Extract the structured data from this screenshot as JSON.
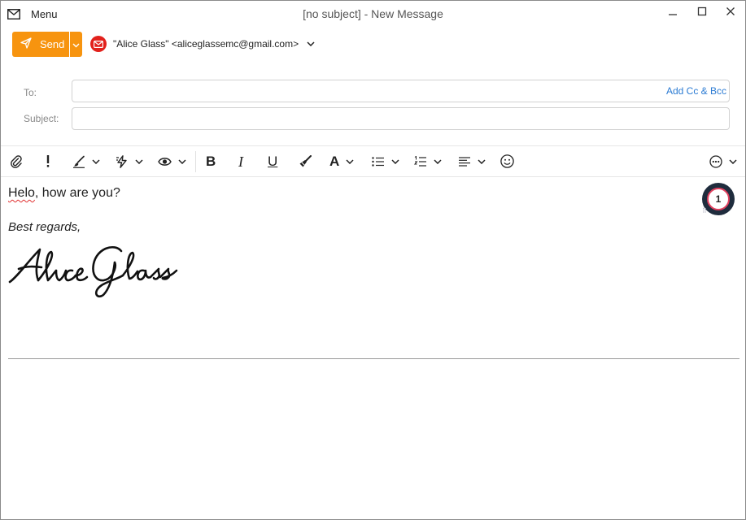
{
  "window": {
    "title": "[no subject] - New Message",
    "menu_label": "Menu",
    "controls": [
      "minimize-icon",
      "maximize-icon",
      "close-icon"
    ]
  },
  "compose": {
    "send_label": "Send",
    "from": "\"Alice Glass\" <aliceglassemc@gmail.com>",
    "to_label": "To:",
    "to_value": "",
    "subject_label": "Subject:",
    "subject_value": "",
    "add_cc_bcc": "Add Cc & Bcc"
  },
  "toolbar": {
    "buttons": [
      "attach-icon",
      "priority-icon",
      "style-icon",
      "quick-action-icon",
      "preview-icon",
      "bold-icon",
      "italic-icon",
      "underline-icon",
      "clear-format-icon",
      "font-icon",
      "bullet-list-icon",
      "numbered-list-icon",
      "align-icon",
      "emoji-icon",
      "more-icon"
    ],
    "bold_glyph": "B",
    "italic_glyph": "I",
    "underline_glyph": "U",
    "font_glyph": "A"
  },
  "body": {
    "greeting_word": "Helo",
    "greeting_rest": ", how are you?",
    "closing": "Best regards,",
    "signature": "Alice Glass"
  },
  "badge": {
    "count": "1"
  },
  "colors": {
    "accent": "#f7940f",
    "link": "#2b7bd3",
    "from_icon": "#e2211c",
    "badge_ring": "#e0405e",
    "badge_bg": "#1f2c3d"
  }
}
